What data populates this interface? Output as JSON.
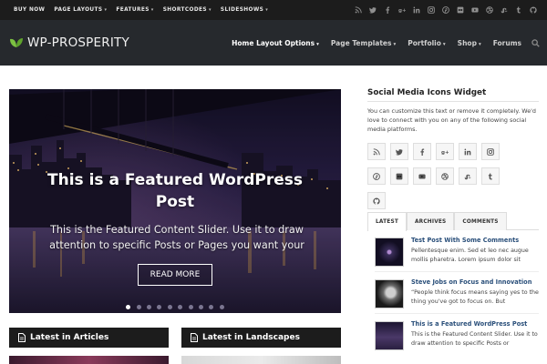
{
  "topnav": {
    "items": [
      {
        "label": "BUY NOW",
        "caret": false
      },
      {
        "label": "PAGE LAYOUTS",
        "caret": true
      },
      {
        "label": "FEATURES",
        "caret": true
      },
      {
        "label": "SHORTCODES",
        "caret": true
      },
      {
        "label": "SLIDESHOWS",
        "caret": true
      }
    ],
    "caret_glyph": "▾",
    "icons": [
      "rss-icon",
      "twitter-icon",
      "facebook-icon",
      "google-plus-icon",
      "linkedin-icon",
      "instagram-icon",
      "pinterest-icon",
      "flickr-icon",
      "youtube-icon",
      "dribbble-icon",
      "stumbleupon-icon",
      "tumblr-icon",
      "github-icon"
    ]
  },
  "header": {
    "logo_text": "WP-PROSPERITY",
    "nav": [
      {
        "label": "Home Layout Options",
        "caret": true,
        "active": true
      },
      {
        "label": "Page Templates",
        "caret": true,
        "active": false
      },
      {
        "label": "Portfolio",
        "caret": true,
        "active": false
      },
      {
        "label": "Shop",
        "caret": true,
        "active": false
      },
      {
        "label": "Forums",
        "caret": false,
        "active": false
      }
    ],
    "search_icon": "search-icon"
  },
  "slider": {
    "title": "This is a Featured WordPress Post",
    "description": "This is the Featured Content Slider. Use it to draw attention to specific Posts or Pages you want your",
    "button_label": "READ MORE",
    "slide_count": 10,
    "active_index": 0
  },
  "sections": {
    "articles_label": "Latest in Articles",
    "landscapes_label": "Latest in Landscapes"
  },
  "sidebar": {
    "widget_title": "Social Media Icons Widget",
    "widget_text": "You can customize this text or remove it completely. We'd love to connect with you on any of the following social media platforms.",
    "social_icons": [
      "rss-icon",
      "twitter-icon",
      "facebook-icon",
      "google-plus-icon",
      "linkedin-icon",
      "instagram-icon",
      "pinterest-icon",
      "flickr-icon",
      "youtube-icon",
      "dribbble-icon",
      "stumbleupon-icon",
      "tumblr-icon",
      "github-icon"
    ],
    "tabs": [
      {
        "label": "LATEST",
        "active": true
      },
      {
        "label": "ARCHIVES",
        "active": false
      },
      {
        "label": "COMMENTS",
        "active": false
      }
    ],
    "posts": [
      {
        "title": "Test Post With Some Comments",
        "excerpt": "Pellentesque enim. Sed et leo nec augue mollis pharetra. Lorem ipsum dolor sit"
      },
      {
        "title": "Steve Jobs on Focus and Innovation",
        "excerpt": "“People think focus means saying yes to the thing you've got to focus on. But"
      },
      {
        "title": "This is a Featured WordPress Post",
        "excerpt": "This is the Featured Content Slider. Use it to draw attention to specific Posts or"
      }
    ]
  },
  "colors": {
    "topbar_bg": "#1c1c1c",
    "header_bg": "#26292d",
    "logo_leaf": "#7cc142",
    "link_blue": "#2a4f7a",
    "section_bg": "#1c1c1c"
  }
}
